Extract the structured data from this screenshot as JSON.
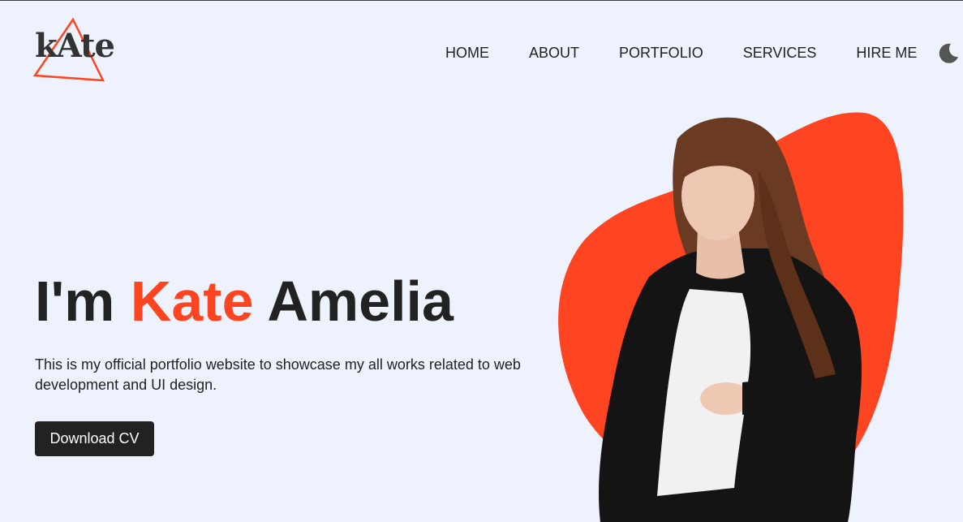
{
  "logo": {
    "text": "kAte"
  },
  "nav": {
    "items": [
      "HOME",
      "ABOUT",
      "PORTFOLIO",
      "SERVICES",
      "HIRE ME"
    ],
    "theme_toggle_icon": "moon-icon"
  },
  "hero": {
    "title_prefix": "I'm ",
    "title_accent": "Kate",
    "title_suffix": " Amelia",
    "description": "This is my official portfolio website to showcase my all works related to web development and UI design.",
    "button_label": "Download CV"
  },
  "colors": {
    "accent": "#ff4422",
    "background": "#eef2fd",
    "text": "#222222",
    "button_bg": "#222222"
  }
}
